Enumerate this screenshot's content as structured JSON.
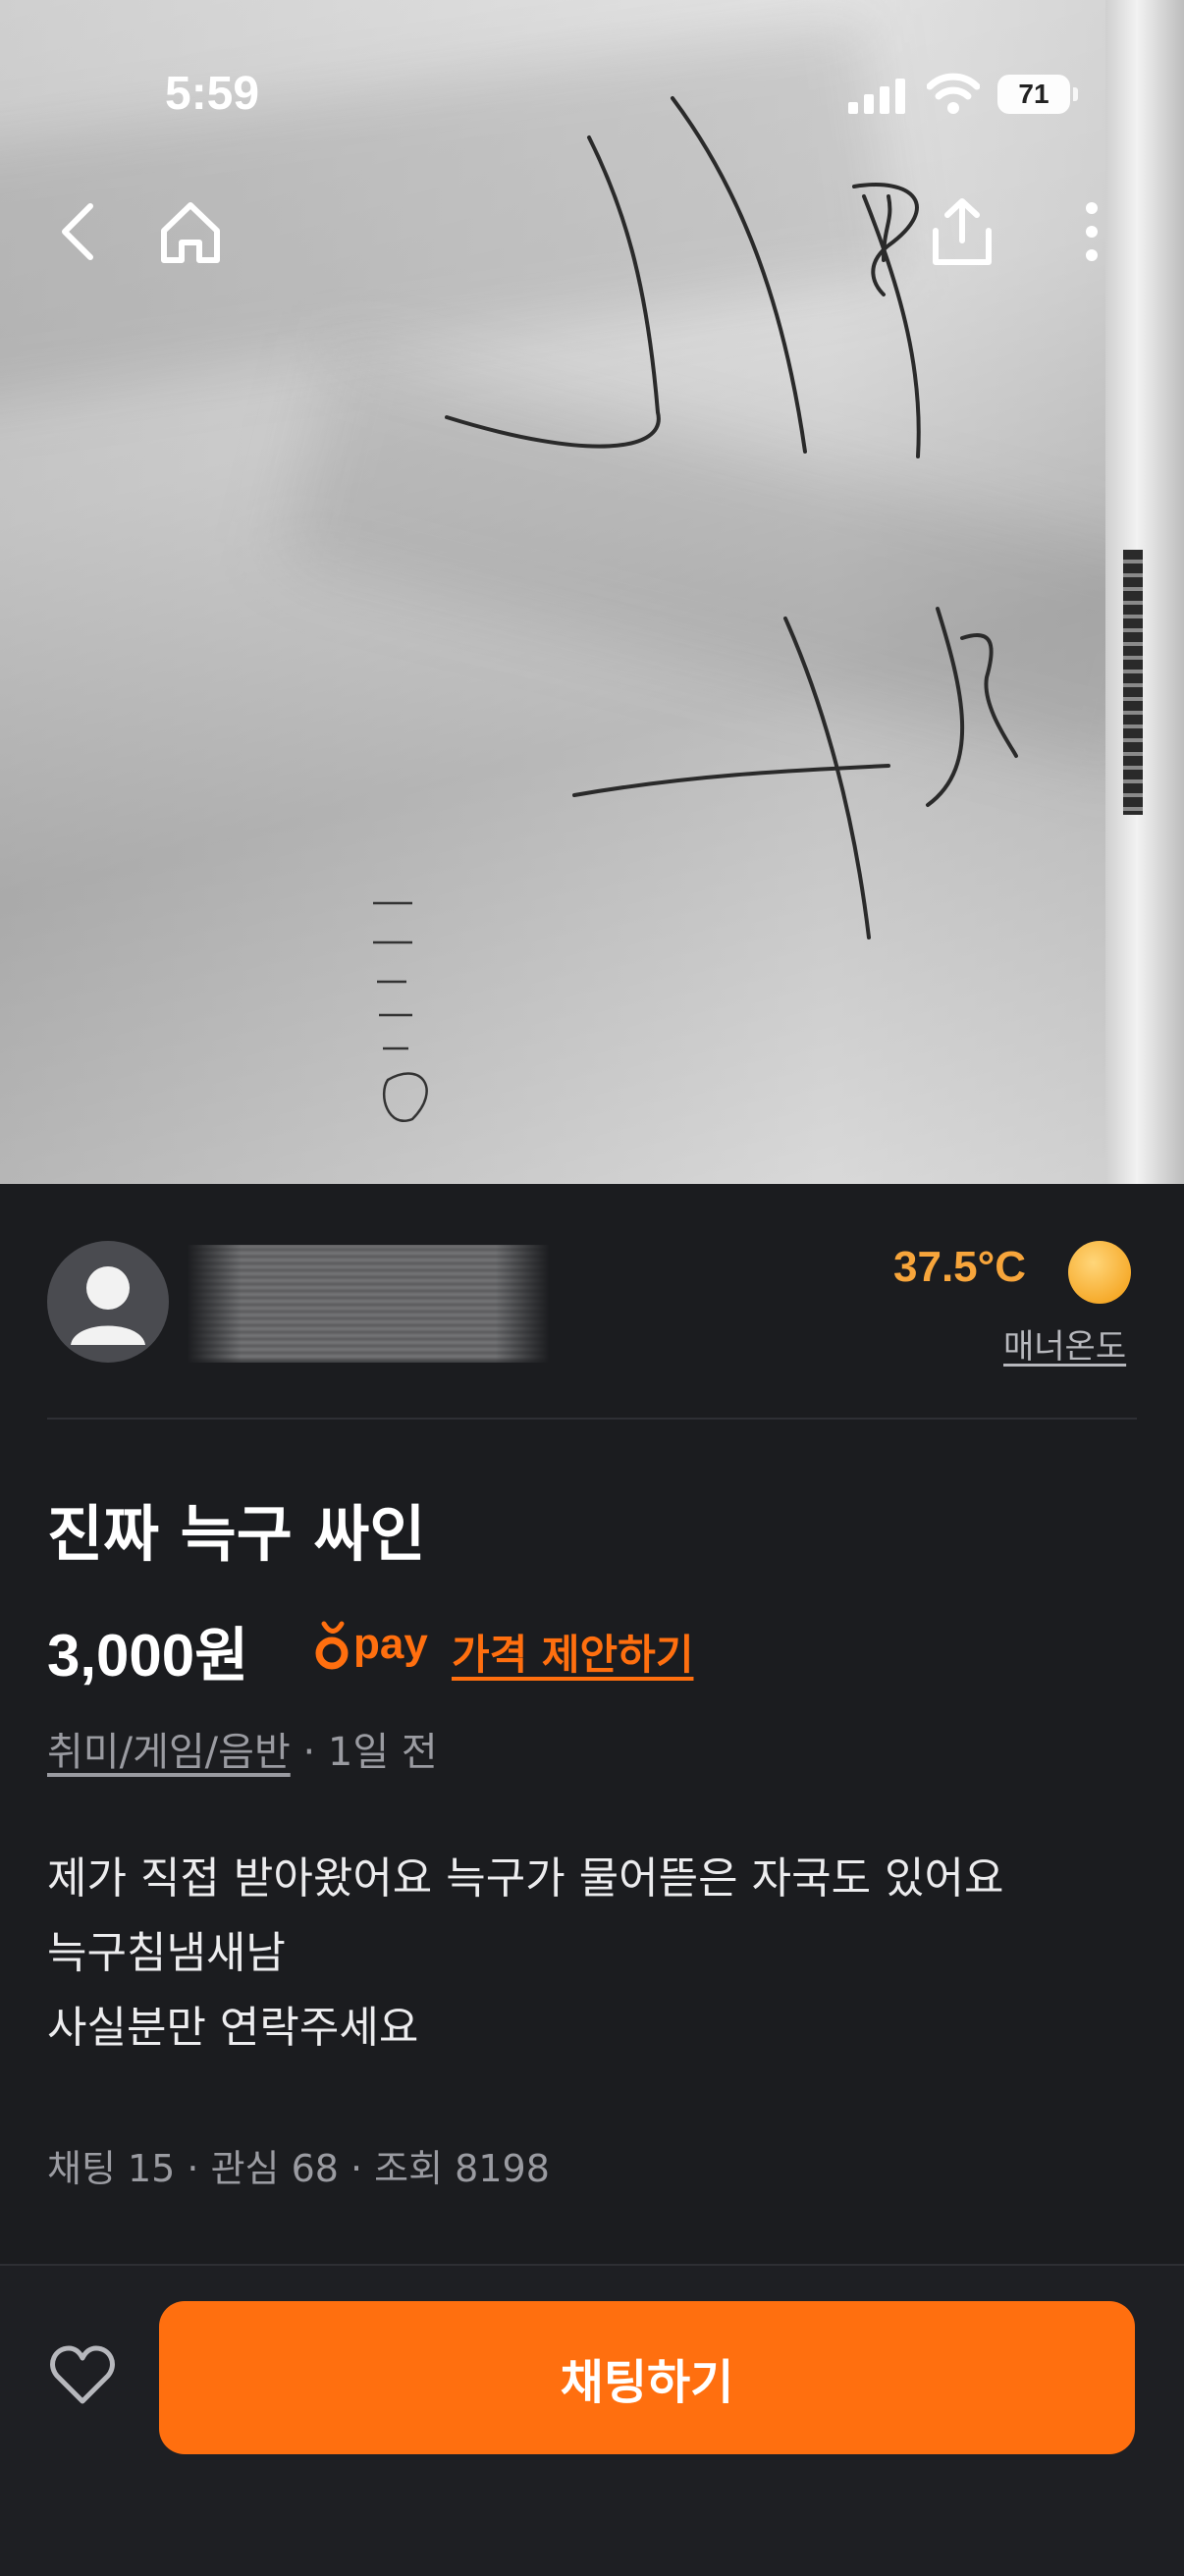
{
  "status_bar": {
    "time": "5:59",
    "battery": "71"
  },
  "icons": {
    "back": "chevron-left-icon",
    "home": "home-icon",
    "share": "share-icon",
    "more": "more-vertical-icon",
    "avatar": "user-icon",
    "temperature": "smile-face-icon",
    "pay": "carrot-pay-icon",
    "favorite": "heart-icon"
  },
  "seller": {
    "manner_temp": "37.5°C",
    "manner_label": "매너온도"
  },
  "listing": {
    "title": "진짜 늑구 싸인",
    "price": "3,000원",
    "pay_label": "pay",
    "offer_link": "가격 제안하기",
    "category": "취미/게임/음반",
    "posted": " · 1일 전",
    "description": [
      "제가 직접 받아왔어요 늑구가 물어뜯은 자국도 있어요",
      "늑구침냄새남",
      "사실분만 연락주세요"
    ],
    "stats": "채팅 15 · 관심 68 · 조회 8198"
  },
  "actions": {
    "chat_button": "채팅하기"
  },
  "colors": {
    "accent": "#ff6f0f",
    "temperature": "#f7a53b",
    "background": "#1b1c1f"
  }
}
